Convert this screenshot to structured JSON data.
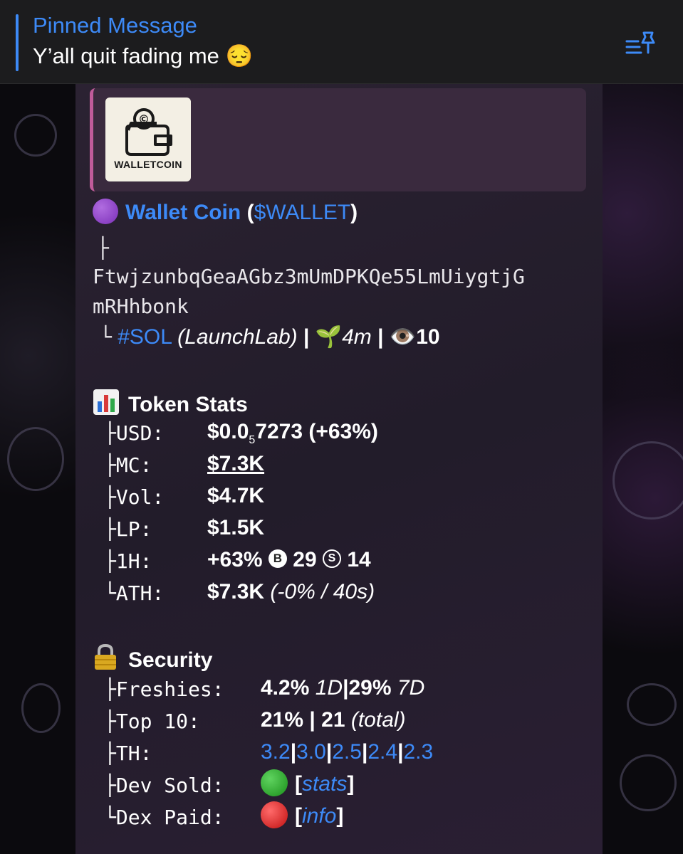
{
  "pinned": {
    "title": "Pinned Message",
    "text": "Y’all quit fading me 😔"
  },
  "preview": {
    "logo_text": "WALLETCOIN"
  },
  "token": {
    "name": "Wallet Coin",
    "open_paren": "(",
    "ticker": "$WALLET",
    "close_paren": ")",
    "branch_top": "├",
    "address_line1": "FtwjzunbqGeaAGbz3mUmDPKQe55LmUiygtjG",
    "address_line2": "mRHhbonk",
    "branch_end": "└",
    "chain": "#SOL",
    "launchpad": "(LaunchLab)",
    "sep": "|",
    "age": "4m",
    "views": "10"
  },
  "stats": {
    "heading": "Token Stats",
    "usd_label": "├USD:",
    "usd_value_prefix": "$0.0",
    "usd_value_sub": "5",
    "usd_value_suffix": "7273 (+63%)",
    "mc_label": "├MC:",
    "mc_value": "$7.3K",
    "vol_label": "├Vol:",
    "vol_value": "$4.7K",
    "lp_label": "├LP:",
    "lp_value": "$1.5K",
    "h1_label": "├1H:",
    "h1_change": "+63%",
    "h1_buys": "29",
    "h1_sells": "14",
    "ath_label": "└ATH:",
    "ath_value": "$7.3K",
    "ath_detail": "(-0% / 40s)"
  },
  "security": {
    "heading": "Security",
    "freshies_label": "├Freshies:",
    "freshies_1d": "4.2%",
    "freshies_1d_unit": "1D",
    "freshies_sep": "|",
    "freshies_7d": "29%",
    "freshies_7d_unit": "7D",
    "top10_label": "├Top 10:",
    "top10_value": "21%",
    "top10_sep": "|",
    "top10_count": "21",
    "top10_total": "(total)",
    "th_label": "├TH:",
    "th_values": [
      "3.2",
      "3.0",
      "2.5",
      "2.4",
      "2.3"
    ],
    "th_sep": "|",
    "dev_label": "├Dev Sold:",
    "dev_link": "stats",
    "dex_label": "└Dex Paid:",
    "dex_link": "info",
    "bracket_open": "[",
    "bracket_close": "]"
  },
  "colors": {
    "link": "#3d8af7",
    "accent_preview": "#c05b9a",
    "green_dot": "#1fa31f",
    "red_dot": "#d81b1b",
    "purple_dot": "#8e44c9"
  }
}
